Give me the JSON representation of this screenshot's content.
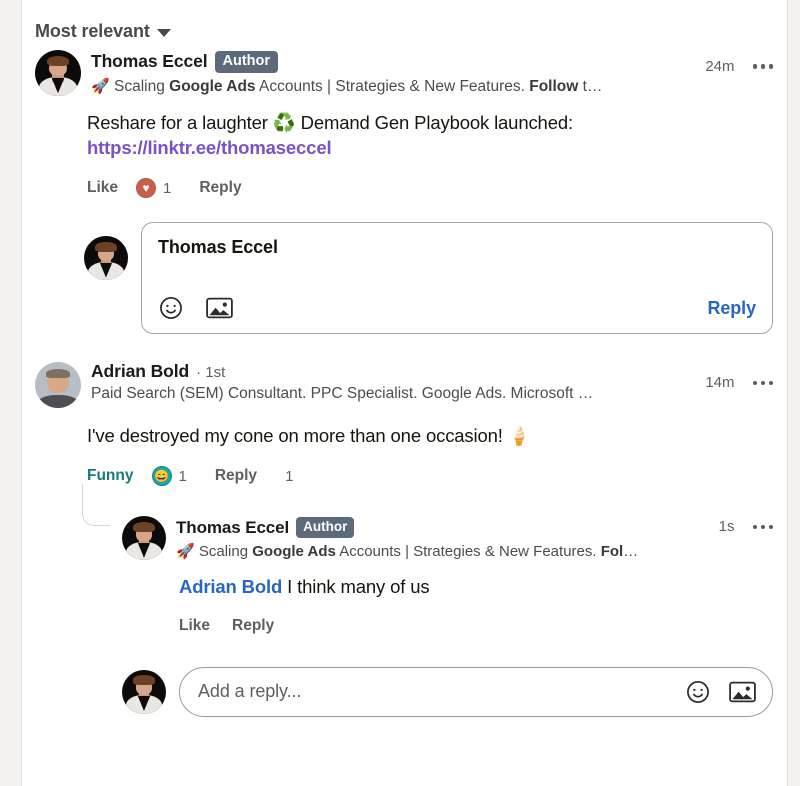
{
  "sort": {
    "label": "Most relevant",
    "icon": "chevron-down-icon"
  },
  "comments": [
    {
      "id": "comment-1",
      "author": {
        "name": "Thomas Eccel",
        "badge": "Author",
        "avatar": "thomas-eccel-avatar"
      },
      "headline_emoji": "🚀",
      "headline_pre": " Scaling ",
      "headline_bold": "Google Ads",
      "headline_mid": " Accounts | Strategies & New Features. ",
      "headline_bold2": "Follow",
      "headline_post": " t…",
      "time": "24m",
      "body_pre": "Reshare for a laughter ",
      "body_emoji": "♻️",
      "body_mid": " Demand Gen Playbook launched: ",
      "body_link": "https://linktr.ee/thomaseccel",
      "actions": {
        "like": "Like",
        "reaction_icon": "love-reaction-icon",
        "reaction_glyph": "♥",
        "reaction_count": "1",
        "reply": "Reply"
      },
      "editor": {
        "avatar": "thomas-eccel-avatar",
        "value": "Thomas Eccel",
        "emoji_icon": "emoji-icon",
        "image_icon": "image-icon",
        "submit_label": "Reply"
      }
    },
    {
      "id": "comment-2",
      "author": {
        "name": "Adrian Bold",
        "degree": "· 1st",
        "avatar": "adrian-bold-avatar"
      },
      "headline": "Paid Search (SEM) Consultant. PPC Specialist. Google Ads. Microsoft …",
      "time": "14m",
      "body": "I've destroyed my cone on more than one occasion! 🍦",
      "actions": {
        "reaction_label": "Funny",
        "reaction_icon": "funny-reaction-icon",
        "reaction_glyph": "😄",
        "reaction_count": "1",
        "reply": "Reply",
        "reply_count": "1"
      },
      "replies": [
        {
          "id": "reply-1",
          "author": {
            "name": "Thomas Eccel",
            "badge": "Author",
            "avatar": "thomas-eccel-avatar"
          },
          "headline_emoji": "🚀",
          "headline_pre": " Scaling ",
          "headline_bold": "Google Ads",
          "headline_mid": " Accounts | Strategies & New Features. ",
          "headline_bold2": "Fol",
          "headline_post": "…",
          "time": "1s",
          "body_mention": "Adrian Bold",
          "body_text": " I think many of us",
          "actions": {
            "like": "Like",
            "reply": "Reply"
          }
        }
      ]
    }
  ],
  "reply_composer": {
    "avatar": "thomas-eccel-avatar",
    "placeholder": "Add a reply...",
    "emoji_icon": "emoji-icon",
    "image_icon": "image-icon"
  },
  "colors": {
    "page_bg": "#f4f2ee",
    "card_bg": "#ffffff",
    "link_purple": "#7a52c9",
    "linkedin_blue": "#2866bf",
    "reaction_teal": "#157a80",
    "author_badge_bg": "#5d6a7c",
    "text_primary": "#16160f",
    "text_secondary": "#5f5f5b"
  }
}
